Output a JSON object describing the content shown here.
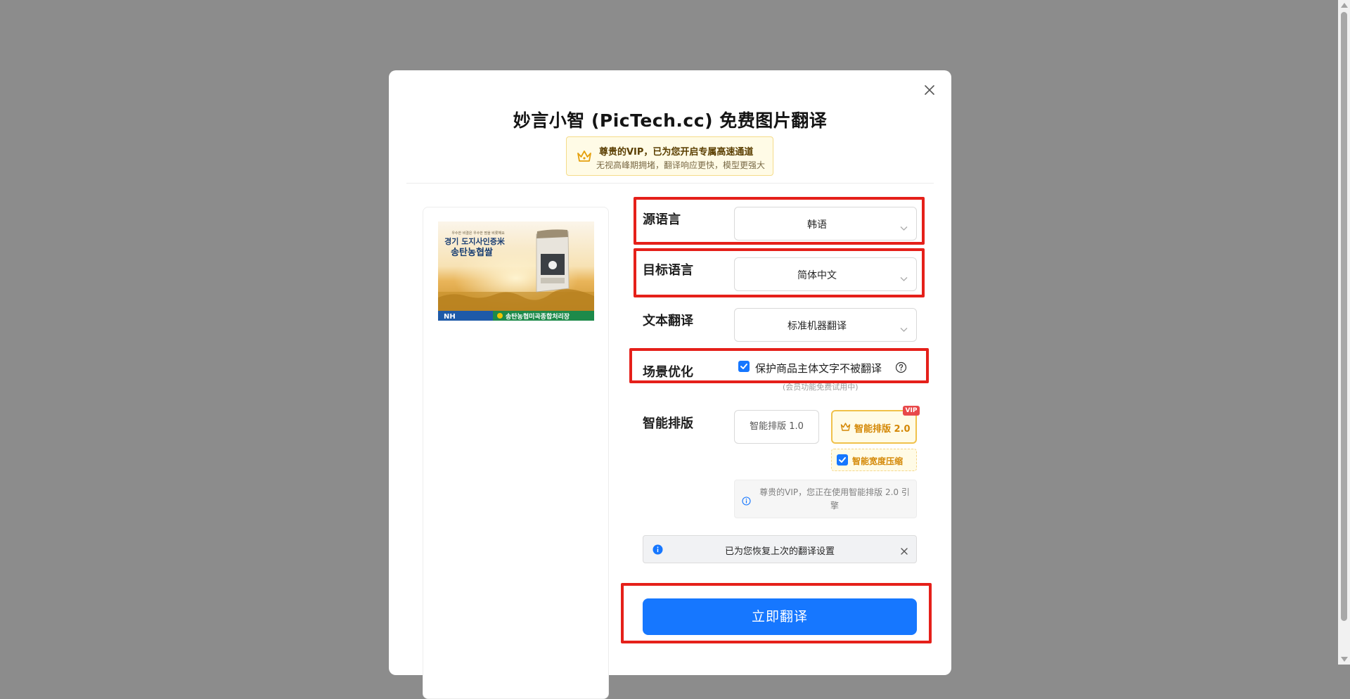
{
  "modal": {
    "title": "妙言小智 (PicTech.cc) 免费图片翻译",
    "vip_banner": {
      "line1": "尊贵的VIP，已为您开启专属高速通道",
      "line2": "无视高峰期拥堵，翻译响应更快，模型更强大"
    },
    "preview": {
      "image_text": {
        "small": "우수한 비결은 우수한 땀을 비롯해요",
        "headline1": "경기 도지사인증米",
        "headline2": "송탄농협쌀",
        "footer_brand": "NH",
        "footer_right": "송탄농협미곡종합처리장"
      }
    },
    "form": {
      "source_language": {
        "label": "源语言",
        "value": "韩语"
      },
      "target_language": {
        "label": "目标语言",
        "value": "简体中文"
      },
      "text_translation": {
        "label": "文本翻译",
        "value": "标准机器翻译"
      },
      "scene": {
        "label": "场景优化",
        "checkbox_label": "保护商品主体文字不被翻译",
        "checked": true,
        "note": "(会员功能免费试用中)"
      },
      "smart_layout": {
        "label": "智能排版",
        "option1": "智能排版 1.0",
        "option2": "智能排版 2.0",
        "vip_tag": "VIP",
        "compress_label": "智能宽度压缩",
        "compress_checked": true,
        "engine_note": "尊贵的VIP，您正在使用智能排版 2.0 引擎"
      }
    },
    "restore_notice": "已为您恢复上次的翻译设置",
    "translate_button": "立即翻译"
  },
  "colors": {
    "overlay": "#8c8c8c",
    "primary": "#1677ff",
    "vip_gold": "#d48806",
    "highlight_red": "#e5201a"
  },
  "icons": [
    "close-icon",
    "crown-icon",
    "chevron-down-icon",
    "check-icon",
    "help-circle-icon",
    "info-icon"
  ]
}
